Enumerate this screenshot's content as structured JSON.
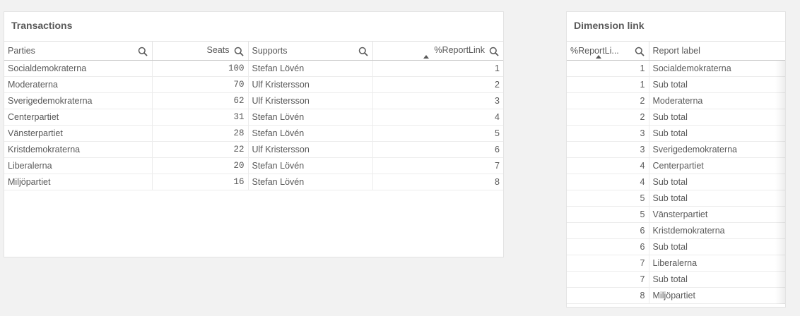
{
  "transactions": {
    "title": "Transactions",
    "columns": {
      "parties": "Parties",
      "seats": "Seats",
      "supports": "Supports",
      "report_link": "%ReportLink"
    },
    "rows": [
      {
        "parties": "Socialdemokraterna",
        "seats": "100",
        "supports": "Stefan Lövén",
        "report_link": "1"
      },
      {
        "parties": "Moderaterna",
        "seats": "70",
        "supports": "Ulf Kristersson",
        "report_link": "2"
      },
      {
        "parties": "Sverigedemokraterna",
        "seats": "62",
        "supports": "Ulf Kristersson",
        "report_link": "3"
      },
      {
        "parties": "Centerpartiet",
        "seats": "31",
        "supports": "Stefan Lövén",
        "report_link": "4"
      },
      {
        "parties": "Vänsterpartiet",
        "seats": "28",
        "supports": "Stefan Lövén",
        "report_link": "5"
      },
      {
        "parties": "Kristdemokraterna",
        "seats": "22",
        "supports": "Ulf Kristersson",
        "report_link": "6"
      },
      {
        "parties": "Liberalerna",
        "seats": "20",
        "supports": "Stefan Lövén",
        "report_link": "7"
      },
      {
        "parties": "Miljöpartiet",
        "seats": "16",
        "supports": "Stefan Lövén",
        "report_link": "8"
      }
    ]
  },
  "dimension_link": {
    "title": "Dimension link",
    "columns": {
      "report_link": "%ReportLi...",
      "report_label": "Report label"
    },
    "rows": [
      {
        "report_link": "1",
        "report_label": "Socialdemokraterna"
      },
      {
        "report_link": "1",
        "report_label": "Sub total"
      },
      {
        "report_link": "2",
        "report_label": "Moderaterna"
      },
      {
        "report_link": "2",
        "report_label": "Sub total"
      },
      {
        "report_link": "3",
        "report_label": "Sub total"
      },
      {
        "report_link": "3",
        "report_label": "Sverigedemokraterna"
      },
      {
        "report_link": "4",
        "report_label": "Centerpartiet"
      },
      {
        "report_link": "4",
        "report_label": "Sub total"
      },
      {
        "report_link": "5",
        "report_label": "Sub total"
      },
      {
        "report_link": "5",
        "report_label": "Vänsterpartiet"
      },
      {
        "report_link": "6",
        "report_label": "Kristdemokraterna"
      },
      {
        "report_link": "6",
        "report_label": "Sub total"
      },
      {
        "report_link": "7",
        "report_label": "Liberalerna"
      },
      {
        "report_link": "7",
        "report_label": "Sub total"
      },
      {
        "report_link": "8",
        "report_label": "Miljöpartiet"
      }
    ]
  },
  "icons": {
    "search": "search-icon",
    "sort": "sort-ascending-icon"
  },
  "colors": {
    "background": "#f2f2f2",
    "panel": "#ffffff",
    "text": "#595959"
  }
}
